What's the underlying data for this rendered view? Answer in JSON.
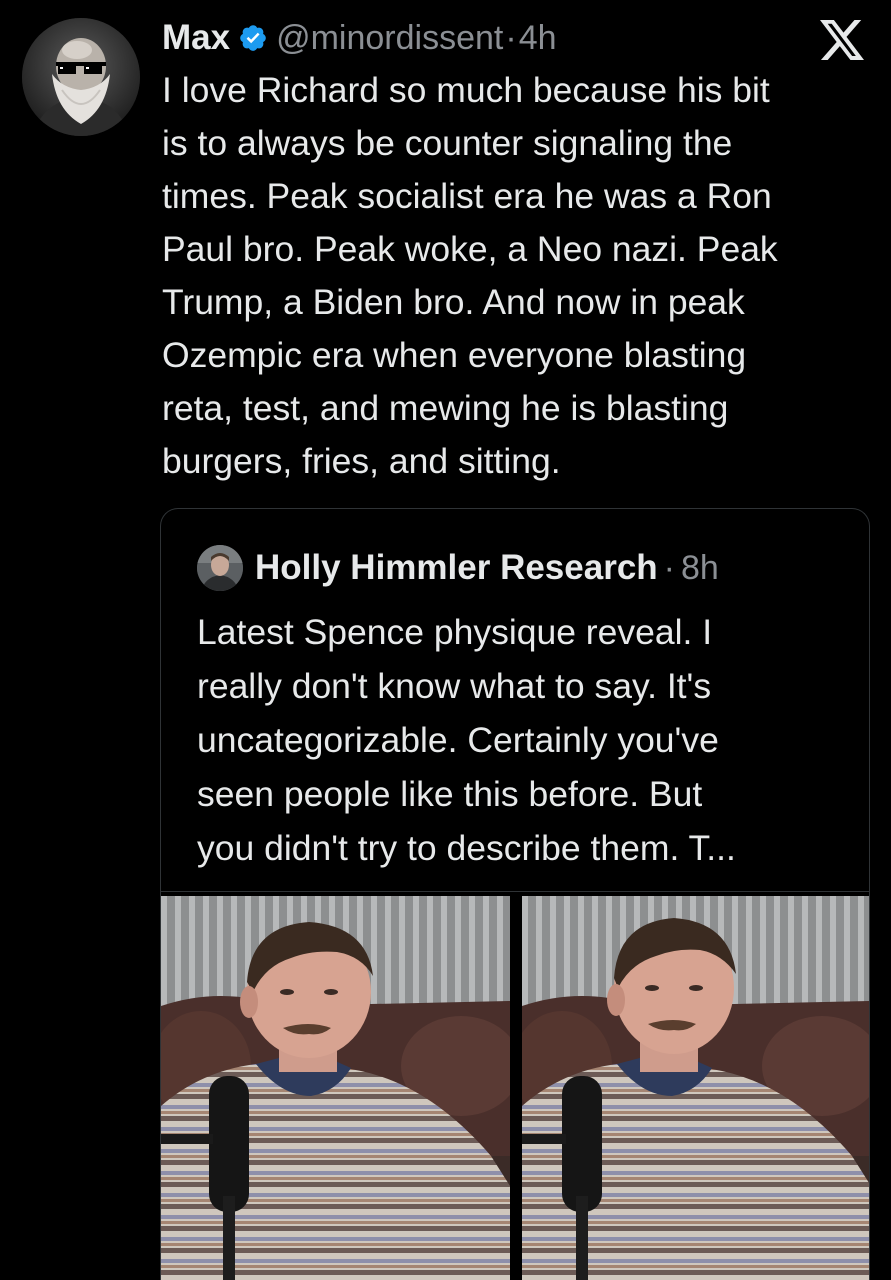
{
  "tweet": {
    "author": {
      "name": "Max",
      "handle": "@minordissent",
      "separator": "·",
      "time": "4h",
      "verified": true,
      "avatar": "avatar-bearded-man-sunglasses"
    },
    "platform_icon": "x-logo-icon",
    "text_lines": [
      "I love Richard so much because his bit",
      "is to always be counter signaling the",
      "times. Peak socialist era he was a Ron",
      "Paul bro. Peak woke, a Neo nazi. Peak",
      "Trump, a Biden bro. And now in peak",
      "Ozempic era when everyone blasting",
      "reta, test, and mewing he is blasting",
      "burgers, fries, and sitting."
    ]
  },
  "quote": {
    "author": {
      "name": "Holly Himmler Research",
      "separator": "·",
      "time": "8h",
      "avatar": "avatar-man-portrait"
    },
    "text_lines": [
      "Latest Spence physique reveal. I",
      "really don't know what to say. It's",
      "uncategorizable. Certainly you've",
      "seen people like this before. But",
      "you didn't try to describe them. T..."
    ],
    "media": [
      {
        "name": "photo-man-with-microphone-1"
      },
      {
        "name": "photo-man-with-microphone-2"
      }
    ]
  },
  "colors": {
    "background": "#000000",
    "text_primary": "#e7e9ea",
    "text_secondary": "#8b8f94",
    "border": "#2f3336",
    "verified_blue": "#1d9bf0"
  }
}
